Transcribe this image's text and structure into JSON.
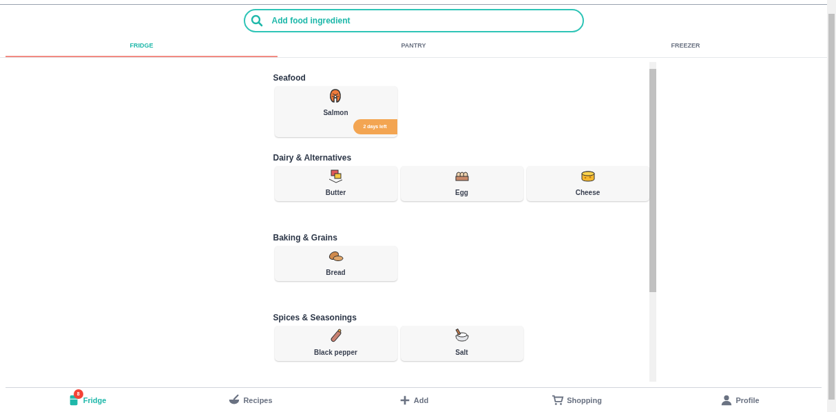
{
  "search": {
    "placeholder": "Add food ingredient"
  },
  "tabs": [
    {
      "label": "FRIDGE",
      "selected": true
    },
    {
      "label": "PANTRY",
      "selected": false
    },
    {
      "label": "FREEZER",
      "selected": false
    }
  ],
  "sections": [
    {
      "title": "Seafood",
      "items": [
        {
          "name": "Salmon",
          "kind": "salmon",
          "expiry": "2 days left"
        }
      ]
    },
    {
      "title": "Dairy & Alternatives",
      "items": [
        {
          "name": "Butter",
          "kind": "butter"
        },
        {
          "name": "Egg",
          "kind": "egg"
        },
        {
          "name": "Cheese",
          "kind": "cheese"
        }
      ]
    },
    {
      "title": "Baking & Grains",
      "items": [
        {
          "name": "Bread",
          "kind": "bread"
        }
      ]
    },
    {
      "title": "Spices & Seasonings",
      "items": [
        {
          "name": "Black pepper",
          "kind": "pepper"
        },
        {
          "name": "Salt",
          "kind": "salt"
        }
      ]
    }
  ],
  "nav": [
    {
      "label": "Fridge",
      "kind": "fridge",
      "selected": true,
      "badge": "8"
    },
    {
      "label": "Recipes",
      "kind": "recipes",
      "selected": false
    },
    {
      "label": "Add",
      "kind": "add",
      "selected": false
    },
    {
      "label": "Shopping",
      "kind": "cart",
      "selected": false
    },
    {
      "label": "Profile",
      "kind": "profile",
      "selected": false
    }
  ]
}
